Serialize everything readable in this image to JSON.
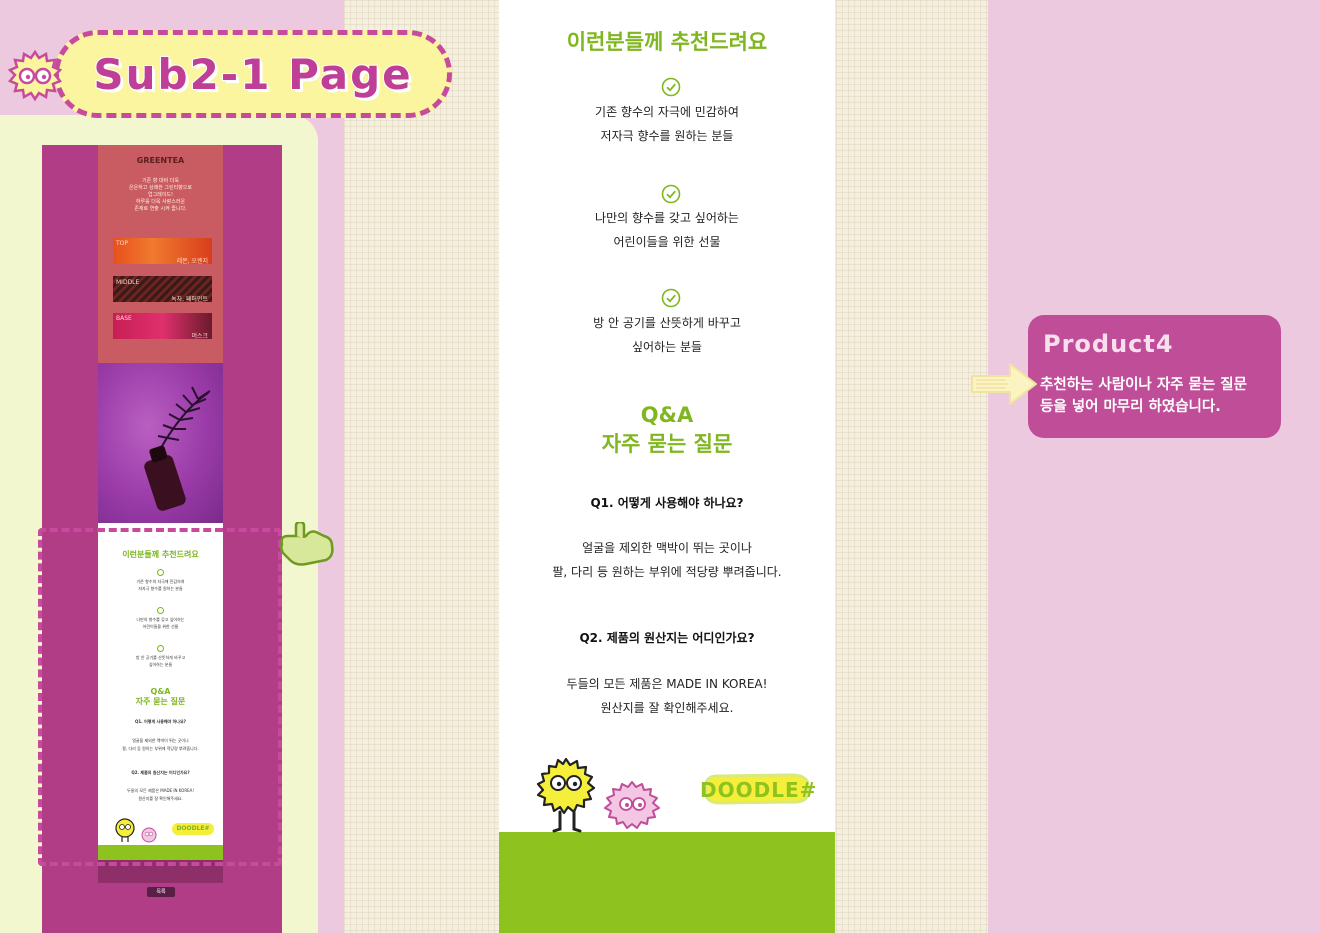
{
  "title_badge": {
    "text": "Sub2-1 Page"
  },
  "thumbnail": {
    "product_name": "GREENTEA",
    "description": [
      "기존 향 대비 더욱",
      "은은하고 상쾌한 그린티향으로",
      "업그레이드!",
      "하루를 더욱 사랑스러운",
      "존재로 연출 시켜 줍니다."
    ],
    "notes": [
      {
        "label": "TOP",
        "value": "레몬, 오렌지"
      },
      {
        "label": "MIDDLE",
        "value": "녹차, 페퍼민트"
      },
      {
        "label": "BASE",
        "value": "머스크"
      }
    ],
    "button_label": "목록"
  },
  "main": {
    "recommend_title": "이런분들께 추천드려요",
    "recommend_items": [
      {
        "line1": "기존 향수의 자극에 민감하여",
        "line2": "저자극 향수를 원하는 분들"
      },
      {
        "line1": "나만의 향수를 갖고 싶어하는",
        "line2": "어린이들을 위한 선물"
      },
      {
        "line1": "방 안 공기를 산뜻하게 바꾸고",
        "line2": "싶어하는 분들"
      }
    ],
    "qa_title_1": "Q&A",
    "qa_title_2": "자주 묻는 질문",
    "faqs": [
      {
        "q": "Q1. 어떻게 사용해야 하나요?",
        "a1": "얼굴을 제외한 맥박이 뛰는 곳이나",
        "a2": "팔, 다리 등 원하는 부위에 적당량 뿌려줍니다."
      },
      {
        "q": "Q2. 제품의 원산지는 어디인가요?",
        "a1": "두들의 모든 제품은 MADE IN KOREA!",
        "a2": "원산지를 잘 확인해주세요."
      }
    ],
    "logo_text": "DOODLE#"
  },
  "callout": {
    "title": "Product4",
    "line1": "추천하는 사람이나 자주 묻는 질문",
    "line2": "등을 넣어 마무리 하였습니다."
  },
  "colors": {
    "accent_pink": "#c04d98",
    "lime": "#8dc21f",
    "heading_green": "#80b620",
    "cream": "#f2f7cf",
    "soft_pink": "#ecc9de"
  }
}
